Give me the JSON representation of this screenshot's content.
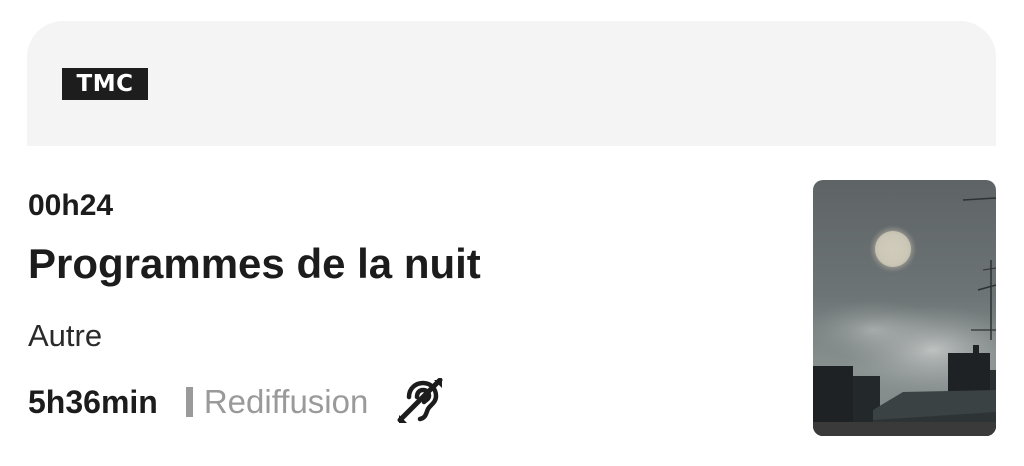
{
  "channel": {
    "logo_text": "TMC"
  },
  "program": {
    "time": "00h24",
    "title": "Programmes de la nuit",
    "genre": "Autre",
    "duration": "5h36min",
    "status": "Rediffusion"
  },
  "icons": {
    "accessibility": "hearing-impaired-icon",
    "thumbnail": "night-sky-moon-rooftops"
  },
  "colors": {
    "header_bg": "#f4f4f4",
    "text_primary": "#1c1c1c",
    "text_muted": "#9a9a9a",
    "logo_bg": "#1d1d1d"
  }
}
